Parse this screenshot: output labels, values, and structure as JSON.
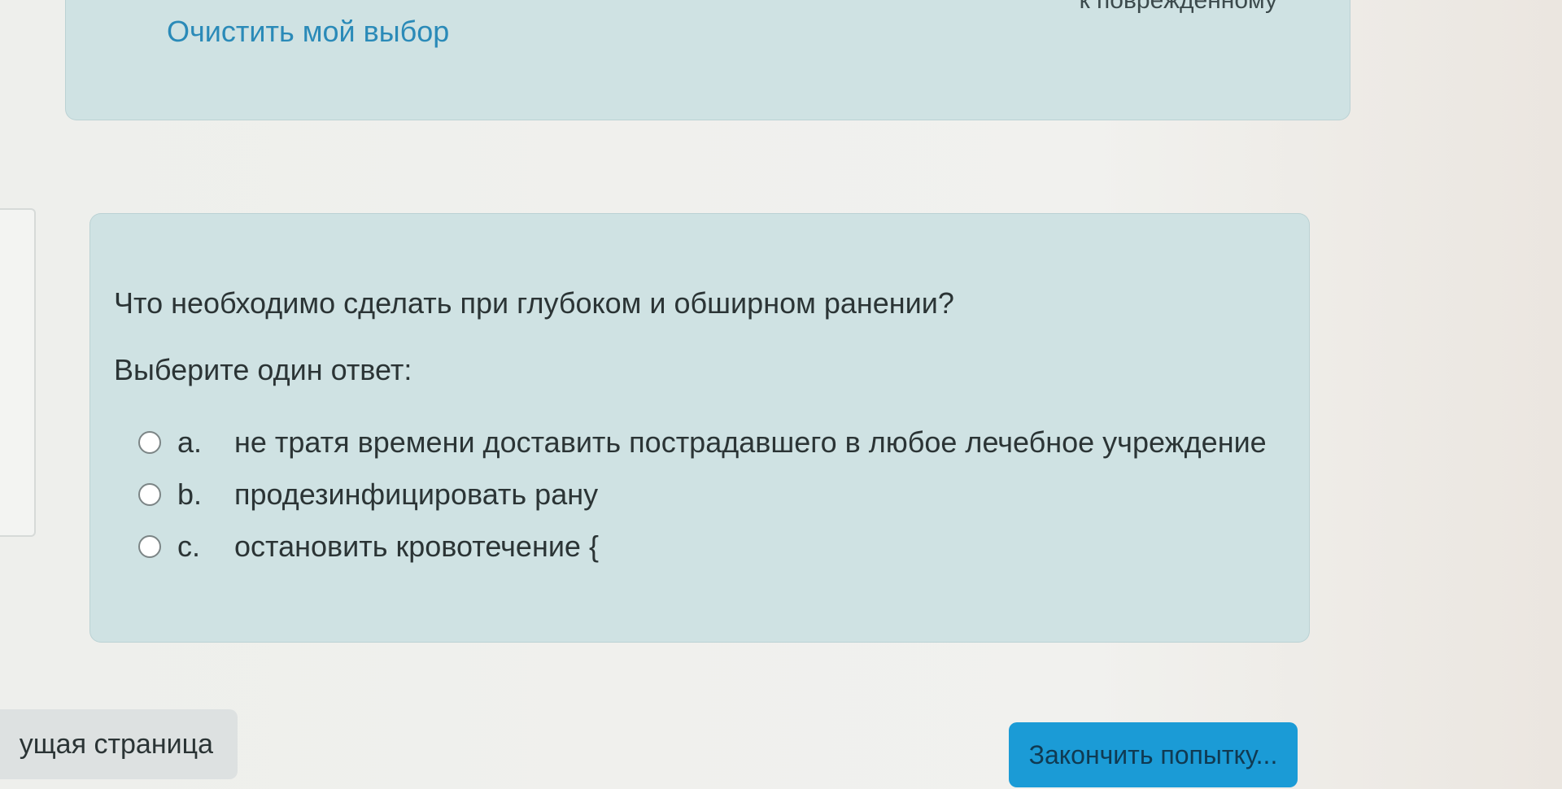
{
  "previous_question": {
    "answer_tail": "к поврежденному",
    "clear_choice_label": "Очистить мой выбор"
  },
  "question": {
    "text": "Что необходимо сделать при глубоком и обширном ранении?",
    "prompt": "Выберите один ответ:",
    "answers": [
      {
        "letter": "a.",
        "text": "не тратя времени доставить пострадавшего в любое лечебное учреждение",
        "selected": false
      },
      {
        "letter": "b.",
        "text": "продезинфицировать рану",
        "selected": false
      },
      {
        "letter": "c.",
        "text": "остановить кровотечение {",
        "selected": false
      }
    ]
  },
  "navigation": {
    "previous_page_label": "ущая страница",
    "finish_attempt_label": "Закончить попытку..."
  },
  "colors": {
    "card_background": "#cfe2e3",
    "link": "#2a8ab8",
    "primary_button": "#1b9bd6"
  }
}
